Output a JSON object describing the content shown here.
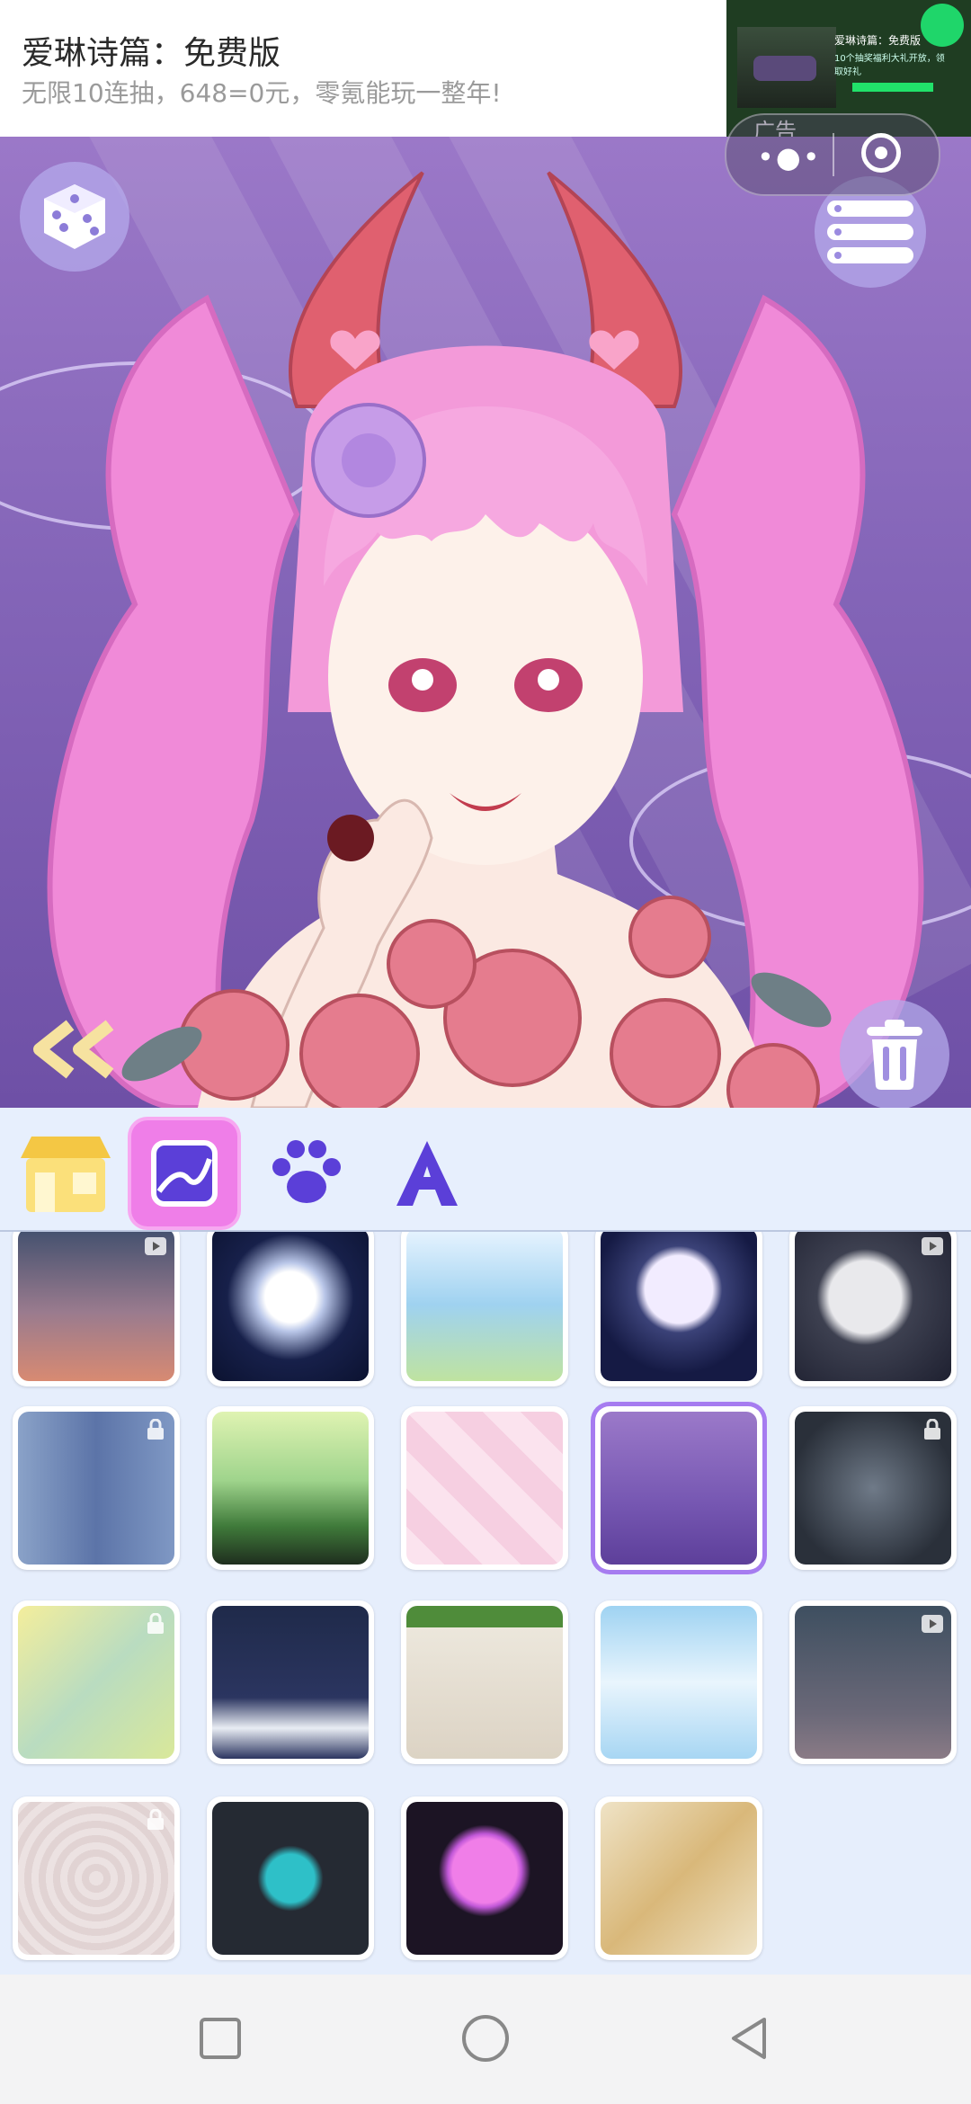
{
  "ad": {
    "title": "爱琳诗篇：免费版",
    "subtitle": "无限10连抽，648=0元，零氪能玩一整年!",
    "thumb_title": "爱琳诗篇：免费版",
    "thumb_text": "10个抽奖福利大礼开放，领取好礼",
    "label": "广告"
  },
  "tabs": [
    {
      "name": "shop-icon",
      "active": false
    },
    {
      "name": "background-icon",
      "active": true
    },
    {
      "name": "paw-icon",
      "active": false
    },
    {
      "name": "text-a-icon",
      "active": false
    }
  ],
  "backgrounds": [
    {
      "name": "dusk-sky",
      "locked": false,
      "video": true
    },
    {
      "name": "full-moon-night",
      "locked": false,
      "video": false
    },
    {
      "name": "lily-pond",
      "locked": false,
      "video": false
    },
    {
      "name": "moon-starry",
      "locked": false,
      "video": false
    },
    {
      "name": "grey-moon",
      "locked": false,
      "video": true
    },
    {
      "name": "blue-forest",
      "locked": true,
      "video": false
    },
    {
      "name": "green-mountain",
      "locked": false,
      "video": false
    },
    {
      "name": "pink-patches",
      "locked": false,
      "video": false
    },
    {
      "name": "purple-clouds",
      "locked": false,
      "video": false,
      "selected": true
    },
    {
      "name": "spider-web",
      "locked": true,
      "video": false
    },
    {
      "name": "golden-waves",
      "locked": true,
      "video": false
    },
    {
      "name": "night-waves",
      "locked": false,
      "video": false
    },
    {
      "name": "brick-wall-vines",
      "locked": false,
      "video": false
    },
    {
      "name": "blue-sky-clouds",
      "locked": false,
      "video": false
    },
    {
      "name": "teal-night",
      "locked": false,
      "video": true
    },
    {
      "name": "pink-texture",
      "locked": true,
      "video": false
    },
    {
      "name": "teal-splash",
      "locked": false,
      "video": false
    },
    {
      "name": "pink-bubbles",
      "locked": false,
      "video": false
    },
    {
      "name": "fan-pattern",
      "locked": false,
      "video": false
    }
  ],
  "colors": {
    "accent": "#ef7ee8",
    "selected_border": "#a67cf0",
    "panel_bg": "#e6eefc"
  }
}
